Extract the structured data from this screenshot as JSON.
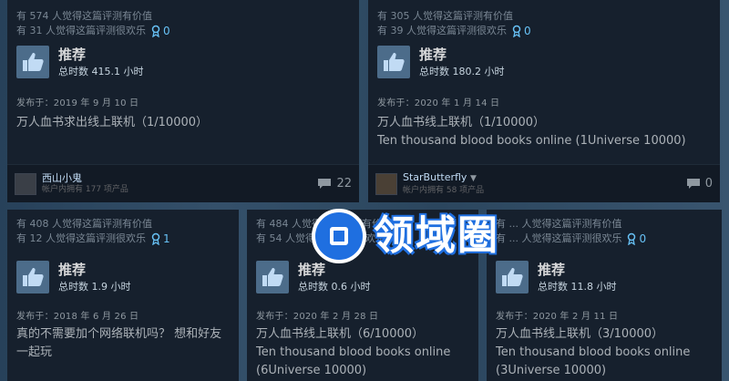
{
  "reviews": [
    {
      "helpful": "有 574 人觉得这篇评测有价值",
      "funny": "有 31 人觉得这篇评测很欢乐",
      "awards": "0",
      "recommend": "推荐",
      "hours": "总时数 415.1 小时",
      "posted": "发布于：2019 年 9 月 10 日",
      "text": "万人血书求出线上联机（1/10000）",
      "text_en": "",
      "author": "西山小鬼",
      "author_sub": "帐户内拥有 177 项产品",
      "comments": "22"
    },
    {
      "helpful": "有 305 人觉得这篇评测有价值",
      "funny": "有 39 人觉得这篇评测很欢乐",
      "awards": "0",
      "recommend": "推荐",
      "hours": "总时数 180.2 小时",
      "posted": "发布于：2020 年 1 月 14 日",
      "text": "万人血书线上联机（1/10000）",
      "text_en": "Ten thousand blood books online (1Universe 10000)",
      "author": "StarButterfly",
      "author_sub": "帐户内拥有 58 项产品",
      "comments": "0"
    },
    {
      "helpful": "有 408 人觉得这篇评测有价值",
      "funny": "有 12 人觉得这篇评测很欢乐",
      "awards": "1",
      "recommend": "推荐",
      "hours": "总时数 1.9 小时",
      "posted": "发布于：2018 年 6 月 26 日",
      "text": "真的不需要加个网络联机吗？ 想和好友一起玩",
      "text_en": ""
    },
    {
      "helpful": "有 484 人觉得这篇评测有价值",
      "funny": "有 54 人觉得这篇评测很欢乐",
      "awards": "0",
      "recommend": "推荐",
      "hours": "总时数 0.6 小时",
      "posted": "发布于：2020 年 2 月 28 日",
      "text": "万人血书线上联机（6/10000）",
      "text_en": "Ten thousand blood books online (6Universe 10000)"
    },
    {
      "helpful": "有 ... 人觉得这篇评测有价值",
      "funny": "有 ... 人觉得这篇评测很欢乐",
      "awards": "0",
      "recommend": "推荐",
      "hours": "总时数 11.8 小时",
      "posted": "发布于：2020 年 2 月 11 日",
      "text": "万人血书线上联机（3/10000）",
      "text_en": "Ten thousand blood books online (3Universe 10000)"
    }
  ],
  "watermark": {
    "text": "领域圈"
  },
  "colors": {
    "card_bg": "#16202d",
    "accent": "#67c1f5",
    "thumb_bg": "#4c6c8a"
  }
}
